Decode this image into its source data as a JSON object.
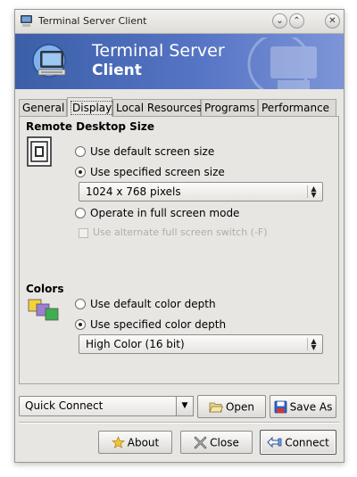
{
  "window": {
    "title": "Terminal Server Client",
    "minimize_glyph": "⌄",
    "maximize_glyph": "⌃",
    "close_glyph": "✕"
  },
  "banner": {
    "title_line1": "Terminal Server",
    "title_line2": "Client"
  },
  "tabs": [
    {
      "label": "General",
      "active": false
    },
    {
      "label": "Display",
      "active": true
    },
    {
      "label": "Local Resources",
      "active": false
    },
    {
      "label": "Programs",
      "active": false
    },
    {
      "label": "Performance",
      "active": false
    }
  ],
  "display": {
    "remote_size": {
      "title": "Remote Desktop Size",
      "opt_default": "Use default screen size",
      "opt_specified": "Use specified screen size",
      "selected": "specified",
      "size_value": "1024 x 768 pixels",
      "opt_fullscreen": "Operate in full screen mode",
      "alt_fullscreen_label": "Use alternate full screen switch (-F)",
      "alt_fullscreen_enabled": false
    },
    "colors": {
      "title": "Colors",
      "opt_default": "Use default color depth",
      "opt_specified": "Use specified color depth",
      "selected": "specified",
      "depth_value": "High Color (16 bit)"
    }
  },
  "bottom": {
    "quick_connect_value": "Quick Connect",
    "open_label": "Open",
    "save_as_label": "Save As",
    "about_label": "About",
    "close_label": "Close",
    "connect_label": "Connect"
  },
  "colors": {
    "banner_start": "#3c5fa8",
    "banner_end": "#7d95d8",
    "window_bg": "#e8e6e3"
  }
}
